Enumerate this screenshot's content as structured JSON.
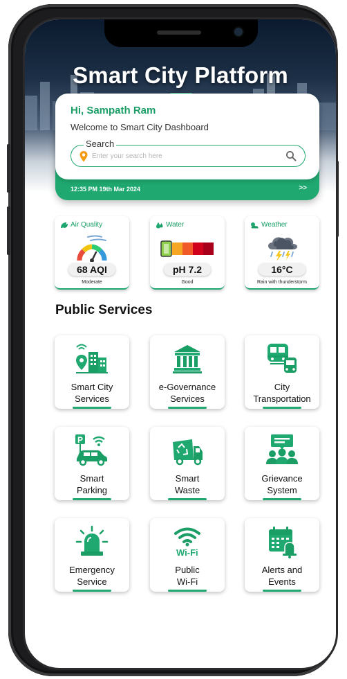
{
  "header": {
    "title": "Smart City Platform"
  },
  "welcome": {
    "greeting": "Hi, Sampath Ram",
    "subtitle": "Welcome to Smart City Dashboard",
    "search_label": "Search",
    "search_placeholder": "Enter your search here",
    "datetime": "12:35 PM 19th Mar 2024",
    "more": ">>"
  },
  "stats": [
    {
      "label": "Air Quality",
      "value": "68 AQI",
      "caption": "Moderate",
      "icon": "leaves-icon"
    },
    {
      "label": "Water",
      "value": "pH 7.2",
      "caption": "Good",
      "icon": "water-drops-icon"
    },
    {
      "label": "Weather",
      "value": "16°C",
      "caption": "Rain with thunderstorm",
      "icon": "cloud-sun-icon"
    }
  ],
  "section_title": "Public Services",
  "services": [
    {
      "label1": "Smart City",
      "label2": "Services",
      "icon": "city-location-icon"
    },
    {
      "label1": "e-Governance",
      "label2": "Services",
      "icon": "government-building-icon"
    },
    {
      "label1": "City",
      "label2": "Transportation",
      "icon": "train-bus-icon"
    },
    {
      "label1": "Smart",
      "label2": "Parking",
      "icon": "parking-car-icon"
    },
    {
      "label1": "Smart",
      "label2": "Waste",
      "icon": "recycle-truck-icon"
    },
    {
      "label1": "Grievance",
      "label2": "System",
      "icon": "grievance-people-icon"
    },
    {
      "label1": "Emergency",
      "label2": "Service",
      "icon": "siren-icon"
    },
    {
      "label1": "Public",
      "label2": "Wi-Fi",
      "icon": "wifi-icon"
    },
    {
      "label1": "Alerts and",
      "label2": "Events",
      "icon": "calendar-bell-icon"
    }
  ],
  "colors": {
    "accent": "#1fa870",
    "accent_dark": "#1a9e66"
  }
}
